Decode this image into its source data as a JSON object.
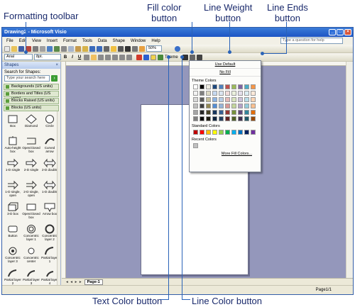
{
  "callouts": {
    "formatting_toolbar": "Formatting toolbar",
    "fill_color": [
      "Fill color",
      "button"
    ],
    "line_weight": [
      "Line Weight",
      "button"
    ],
    "line_ends": [
      "Line Ends",
      "button"
    ],
    "text_color": "Text Color button",
    "line_color": "Line Color button"
  },
  "window": {
    "title": "Drawing2 - Microsoft Visio",
    "menus": [
      "File",
      "Edit",
      "View",
      "Insert",
      "Format",
      "Tools",
      "Data",
      "Shape",
      "Window",
      "Help"
    ],
    "help_placeholder": "Type a question for help",
    "zoom": "50%",
    "font": "Arial",
    "font_size": "8pt.",
    "theme_label": "Theme"
  },
  "shapes_pane": {
    "title": "Shapes",
    "search_label": "Search for Shapes:",
    "search_placeholder": "Type your search here",
    "stencils": [
      "Backgrounds (US units)",
      "Borders and Titles (US units)",
      "Blocks Raised (US units)",
      "Blocks (US units)"
    ],
    "shapes": [
      "Box",
      "Diamond",
      "Circle",
      "Auto-height box",
      "Open/closed box",
      "Curved arrow",
      "1-D single",
      "2-D single",
      "2-D double",
      "1-D single, open",
      "2-D single, open",
      "1-D double",
      "3-D box",
      "Open/closed box",
      "Arrow box",
      "Button",
      "Concentric layer 1",
      "Concentric layer 2",
      "Concentric layer 3",
      "Concentric center",
      "Partial layer 1",
      "Partial layer 2",
      "Partial layer 3",
      "Partial layer 4"
    ]
  },
  "fill_menu": {
    "use_default": "Use Default",
    "no_fill": "No Fill",
    "theme_colors_label": "Theme Colors",
    "theme_colors": [
      "#ffffff",
      "#000000",
      "#eeece1",
      "#1f497d",
      "#4f81bd",
      "#c0504d",
      "#9bbb59",
      "#8064a2",
      "#4bacc6",
      "#f79646",
      "#f2f2f2",
      "#7f7f7f",
      "#ddd9c3",
      "#c6d9f0",
      "#dbe5f1",
      "#f2dcdb",
      "#ebf1dd",
      "#e5e0ec",
      "#dbeef3",
      "#fdeada",
      "#d8d8d8",
      "#595959",
      "#c4bd97",
      "#8db3e2",
      "#b8cce4",
      "#e5b9b7",
      "#d7e3bc",
      "#ccc1d9",
      "#b7dde8",
      "#fbd5b5",
      "#bfbfbf",
      "#3f3f3f",
      "#938953",
      "#548dd4",
      "#95b3d7",
      "#d99694",
      "#c3d69b",
      "#b2a2c7",
      "#92cddc",
      "#fac08f",
      "#a5a5a5",
      "#262626",
      "#494429",
      "#17365d",
      "#366092",
      "#953734",
      "#76923c",
      "#5f497a",
      "#31859b",
      "#e36c09",
      "#7f7f7f",
      "#0c0c0c",
      "#1d1b10",
      "#0f243e",
      "#244061",
      "#632423",
      "#4f6128",
      "#3f3151",
      "#205867",
      "#974806"
    ],
    "standard_colors_label": "Standard Colors",
    "standard_colors": [
      "#c00000",
      "#ff0000",
      "#ffc000",
      "#ffff00",
      "#92d050",
      "#00b050",
      "#00b0f0",
      "#0070c0",
      "#002060",
      "#7030a0"
    ],
    "recent_colors_label": "Recent Colors",
    "recent_colors": [
      "#c0c0c0"
    ],
    "more_colors": "More Fill Colors..."
  },
  "bottom": {
    "nav": "◂ ◂ ▸ ▸",
    "page_tab": "Page-1",
    "status": "Page1/1"
  }
}
